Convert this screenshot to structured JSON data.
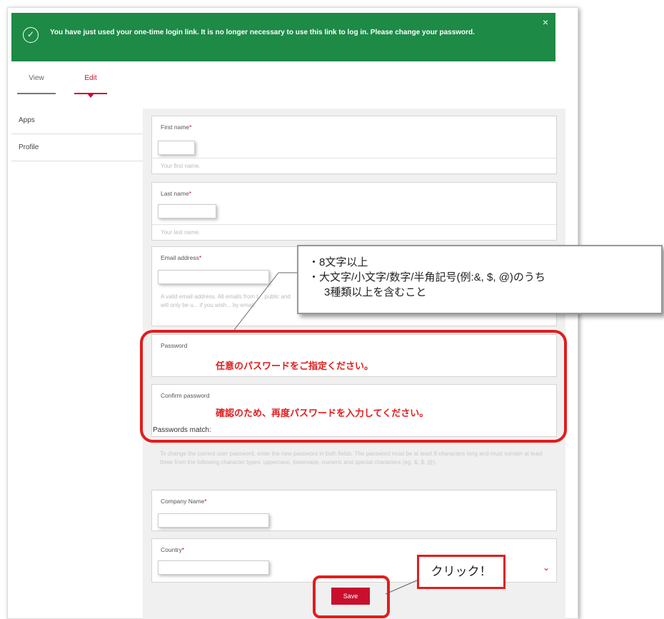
{
  "banner": {
    "message": "You have just used your one-time login link. It is no longer necessary to use this link to log in. Please change your password.",
    "close": "×",
    "check": "✓"
  },
  "tabs": {
    "view": "View",
    "edit": "Edit"
  },
  "sidebar": {
    "items": [
      {
        "label": "Apps"
      },
      {
        "label": "Profile"
      }
    ]
  },
  "form": {
    "first_name": {
      "label": "First name",
      "desc": "Your first name."
    },
    "last_name": {
      "label": "Last name",
      "desc": "Your last name."
    },
    "email": {
      "label": "Email address",
      "desc": "A valid email address. All emails from t... public and will only be u... if you wish... by email."
    },
    "password": {
      "label": "Password",
      "instruction": "任意のパスワードをご指定ください。"
    },
    "confirm": {
      "label": "Confirm password",
      "instruction": "確認のため、再度パスワードを入力してください。"
    },
    "match": "Passwords match:",
    "pw_info": "To change the current user password, enter the new password in both fields. The password must be at least 8 characters long and must contain at least three from the following character types: uppercase, lowercase, numeric and special characters (eg. &, $, @).",
    "company": {
      "label": "Company Name"
    },
    "country": {
      "label": "Country"
    },
    "required_mark": "*",
    "save": "Save"
  },
  "callout": {
    "line1": "・8文字以上",
    "line2": "・大文字/小文字/数字/半角記号(例:&, $, @)のうち",
    "line3": "3種類以上を含むこと"
  },
  "click_note": "クリック！",
  "colors": {
    "banner": "#1d8a46",
    "accent": "#c8102e",
    "annotation": "#e11d1d"
  }
}
